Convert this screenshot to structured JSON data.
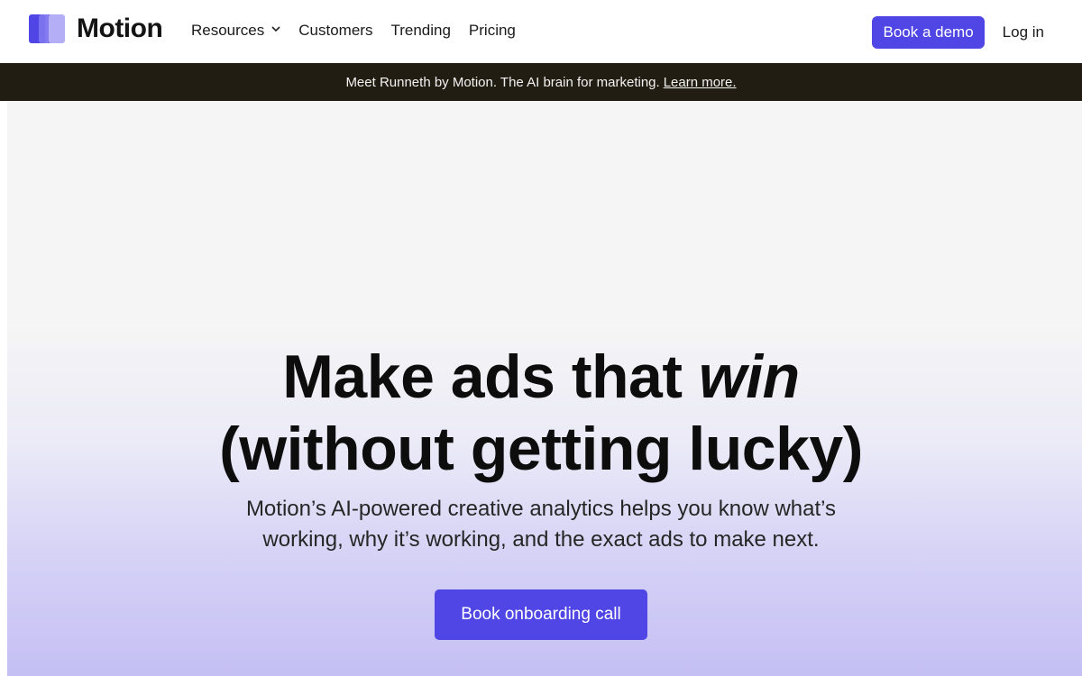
{
  "nav": {
    "brand": "Motion",
    "links": [
      {
        "label": "Resources"
      },
      {
        "label": "Customers"
      },
      {
        "label": "Trending"
      },
      {
        "label": "Pricing"
      }
    ],
    "demo_button": "Book a demo",
    "login": "Log in",
    "resources_chevron_icon": "chevron-down-icon"
  },
  "announcement": {
    "text": "Meet Runneth by Motion. The AI brain for marketing.",
    "link": "Learn more."
  },
  "hero": {
    "headline_part1": "Make ads that ",
    "headline_emphasis": "win",
    "headline_line2": "(without getting lucky)",
    "subhead_line1": "Motion’s AI-powered creative analytics helps you know what’s",
    "subhead_line2": "working, why it’s working, and the exact ads to make next.",
    "cta": "Book onboarding call"
  },
  "colors": {
    "accent": "#4f46e5",
    "announcement_bg": "#221d13"
  }
}
